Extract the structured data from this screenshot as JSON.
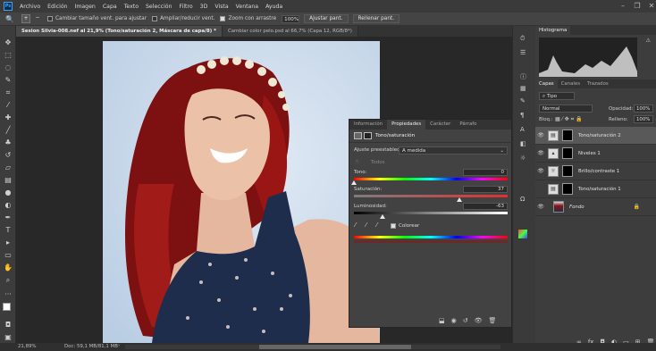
{
  "menus": [
    "Archivo",
    "Edición",
    "Imagen",
    "Capa",
    "Texto",
    "Selección",
    "Filtro",
    "3D",
    "Vista",
    "Ventana",
    "Ayuda"
  ],
  "app_logo": "Ps",
  "options": {
    "check1": "Cambiar tamaño vent. para ajustar",
    "check2": "Ampliar/reducir vent.",
    "check3": "Zoom con arrastre",
    "zoom_value": "100%",
    "btn_fit": "Ajustar pant.",
    "btn_fill": "Rellenar pant."
  },
  "tabs": [
    "Sesion Silvia-008.nef al 21,9% (Tono/saturación 2, Máscara de capa/8) *",
    "Cambiar color pelo.psd al 66,7% (Capa 12, RGB/8*)"
  ],
  "properties": {
    "tabs": [
      "Información",
      "Propiedades",
      "Carácter",
      "Párrafo"
    ],
    "panel_title": "Tono/saturación",
    "preset_label": "Ajuste preestablecido:",
    "preset_value": "A medida",
    "channel": "Todos",
    "tono_label": "Tono:",
    "tono_value": "0",
    "sat_label": "Saturación:",
    "sat_value": "37",
    "lum_label": "Luminosidad:",
    "lum_value": "-63",
    "colorize_label": "Colorear",
    "tono_pos": 0.0,
    "sat_pos": 0.685,
    "lum_pos": 0.185
  },
  "histogram_title": "Histograma",
  "layers_panel": {
    "tabs": [
      "Capas",
      "Canales",
      "Trazados"
    ],
    "filter_label": "Tipo",
    "blend_mode": "Normal",
    "opacity_label": "Opacidad:",
    "opacity_value": "100%",
    "lock_label": "Bloq.:",
    "fill_label": "Relleno:",
    "fill_value": "100%",
    "layers": [
      {
        "name": "Tono/saturación 2",
        "selected": true,
        "visible": true
      },
      {
        "name": "Niveles 1",
        "selected": false,
        "visible": true
      },
      {
        "name": "Brillo/contraste 1",
        "selected": false,
        "visible": true
      },
      {
        "name": "Tono/saturación 1",
        "selected": false,
        "visible": false
      },
      {
        "name": "Fondo",
        "selected": false,
        "visible": true
      }
    ]
  },
  "status": {
    "zoom": "21,89%",
    "doc": "Doc: 59,1 MB/81,1 MB"
  },
  "colors": {
    "accent": "#31a8ff",
    "hair": "#8c1414",
    "dress": "#1e2d4c"
  }
}
